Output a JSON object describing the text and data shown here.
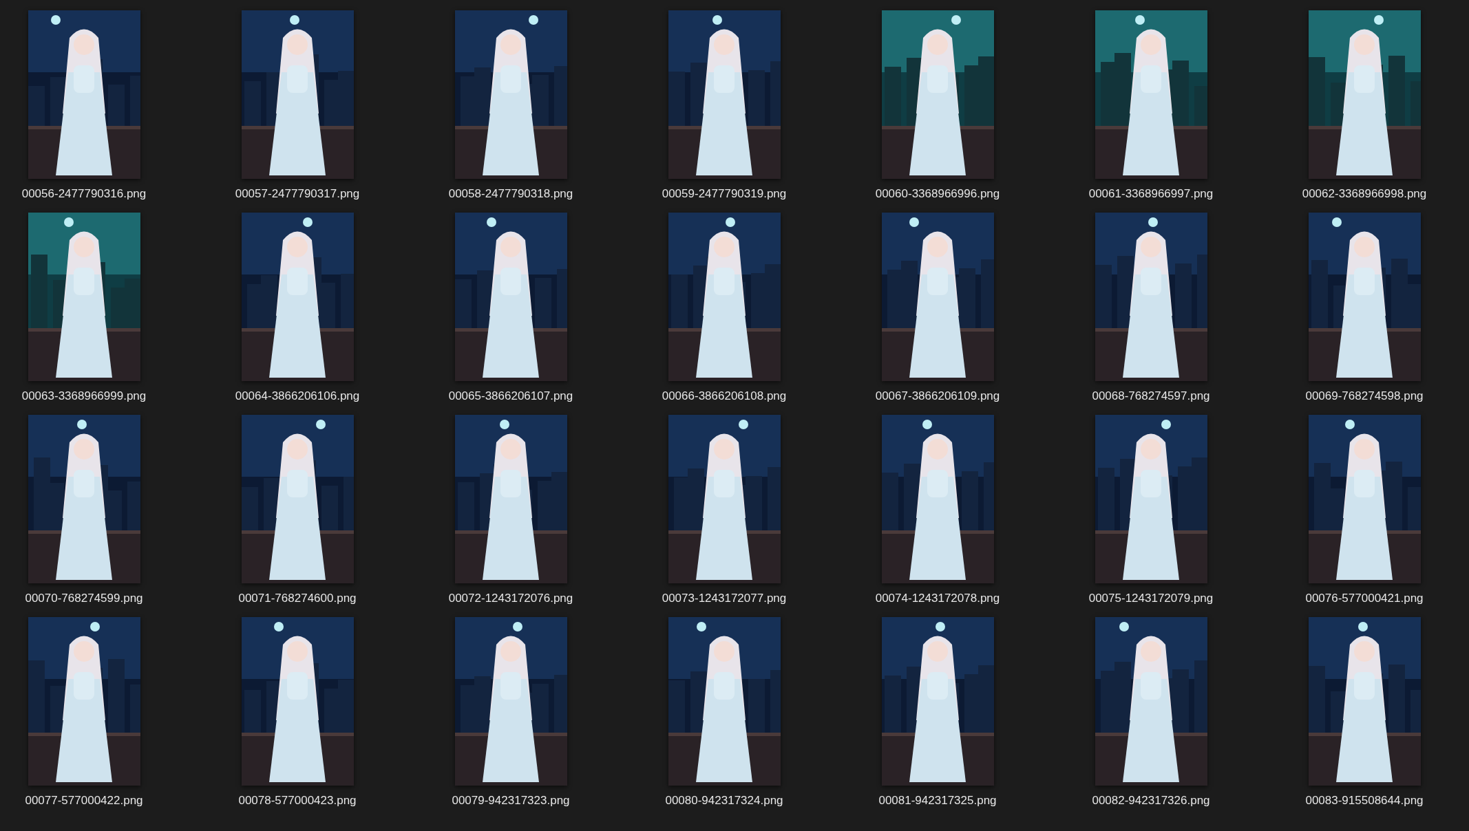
{
  "files": [
    {
      "name": "00056-2477790316.png"
    },
    {
      "name": "00057-2477790317.png"
    },
    {
      "name": "00058-2477790318.png"
    },
    {
      "name": "00059-2477790319.png"
    },
    {
      "name": "00060-3368966996.png"
    },
    {
      "name": "00061-3368966997.png"
    },
    {
      "name": "00062-3368966998.png"
    },
    {
      "name": "00063-3368966999.png"
    },
    {
      "name": "00064-3866206106.png"
    },
    {
      "name": "00065-3866206107.png"
    },
    {
      "name": "00066-3866206108.png"
    },
    {
      "name": "00067-3866206109.png"
    },
    {
      "name": "00068-768274597.png"
    },
    {
      "name": "00069-768274598.png"
    },
    {
      "name": "00070-768274599.png"
    },
    {
      "name": "00071-768274600.png"
    },
    {
      "name": "00072-1243172076.png"
    },
    {
      "name": "00073-1243172077.png"
    },
    {
      "name": "00074-1243172078.png"
    },
    {
      "name": "00075-1243172079.png"
    },
    {
      "name": "00076-577000421.png"
    },
    {
      "name": "00077-577000422.png"
    },
    {
      "name": "00078-577000423.png"
    },
    {
      "name": "00079-942317323.png"
    },
    {
      "name": "00080-942317324.png"
    },
    {
      "name": "00081-942317325.png"
    },
    {
      "name": "00082-942317326.png"
    },
    {
      "name": "00083-915508644.png"
    }
  ]
}
